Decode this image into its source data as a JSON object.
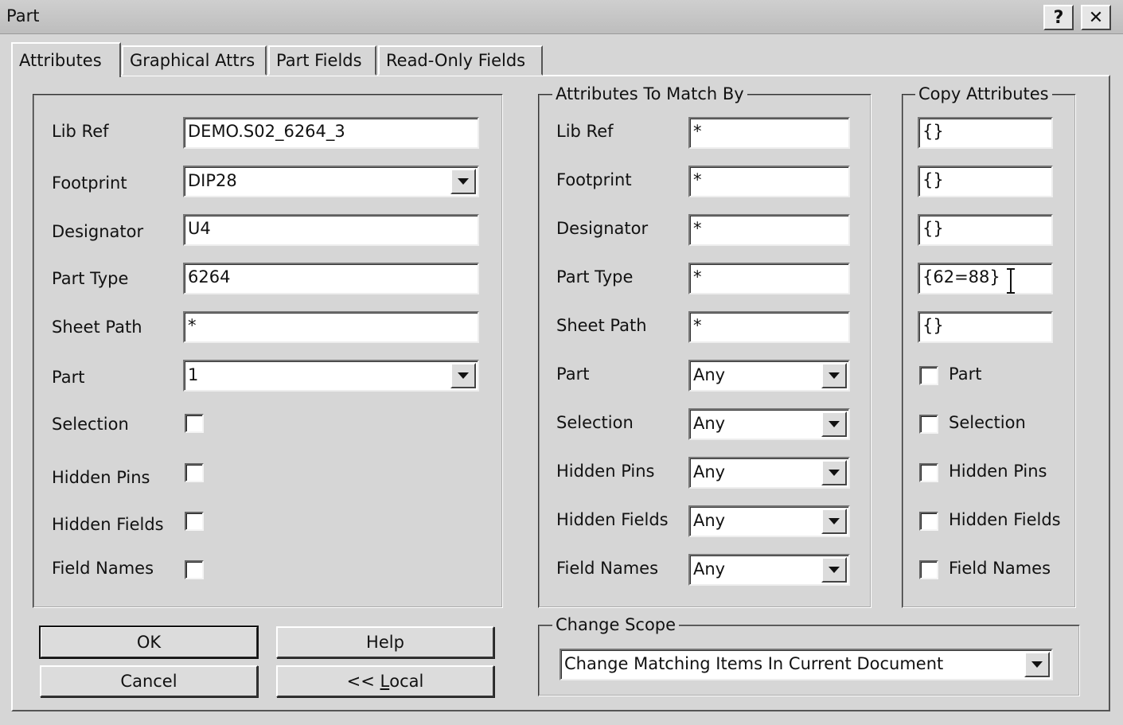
{
  "window": {
    "title": "Part",
    "help_label": "?",
    "close_label": "✕"
  },
  "tabs": [
    "Attributes",
    "Graphical Attrs",
    "Part Fields",
    "Read-Only Fields"
  ],
  "left": {
    "lib_ref_label": "Lib Ref",
    "lib_ref_value": "DEMO.S02_6264_3",
    "footprint_label": "Footprint",
    "footprint_value": "DIP28",
    "designator_label": "Designator",
    "designator_value": "U4",
    "part_type_label": "Part Type",
    "part_type_value": "6264",
    "sheet_path_label": "Sheet Path",
    "sheet_path_value": "*",
    "part_label": "Part",
    "part_value": "1",
    "selection_label": "Selection",
    "hidden_pins_label": "Hidden Pins",
    "hidden_fields_label": "Hidden Fields",
    "field_names_label": "Field Names"
  },
  "match": {
    "title": "Attributes To Match By",
    "lib_ref_label": "Lib Ref",
    "lib_ref_value": "*",
    "footprint_label": "Footprint",
    "footprint_value": "*",
    "designator_label": "Designator",
    "designator_value": "*",
    "part_type_label": "Part Type",
    "part_type_value": "*",
    "sheet_path_label": "Sheet Path",
    "sheet_path_value": "*",
    "part_label": "Part",
    "part_value": "Any",
    "selection_label": "Selection",
    "selection_value": "Any",
    "hidden_pins_label": "Hidden Pins",
    "hidden_pins_value": "Any",
    "hidden_fields_label": "Hidden Fields",
    "hidden_fields_value": "Any",
    "field_names_label": "Field Names",
    "field_names_value": "Any"
  },
  "copy": {
    "title": "Copy Attributes",
    "lib_ref_value": "{}",
    "footprint_value": "{}",
    "designator_value": "{}",
    "part_type_value": "{62=88}",
    "sheet_path_value": "{}",
    "part_label": "Part",
    "selection_label": "Selection",
    "hidden_pins_label": "Hidden Pins",
    "hidden_fields_label": "Hidden Fields",
    "field_names_label": "Field Names"
  },
  "scope": {
    "title": "Change Scope",
    "value": "Change Matching Items In Current Document"
  },
  "buttons": {
    "ok": "OK",
    "help": "Help",
    "cancel": "Cancel",
    "local_prefix": "<< ",
    "local_hotkey": "L",
    "local_rest": "ocal"
  }
}
